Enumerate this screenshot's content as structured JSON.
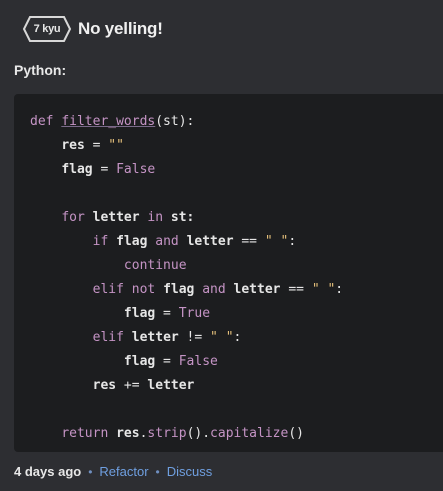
{
  "header": {
    "kyu_label": "7 kyu",
    "title": "No yelling!"
  },
  "language_label": "Python:",
  "code": {
    "l1": {
      "kw": "def",
      "fname": "filter_words",
      "args": "(st):"
    },
    "l2": {
      "var": "res",
      "op": " = ",
      "val": "\"\""
    },
    "l3": {
      "var": "flag",
      "op": " = ",
      "val": "False"
    },
    "l5": {
      "kw": "for",
      "var": "letter",
      "kw2": "in",
      "var2": "st:"
    },
    "l6": {
      "kw": "if",
      "var": "flag",
      "kw2": "and",
      "var2": "letter",
      "op": " == ",
      "val": "\" \"",
      "end": ":"
    },
    "l7": {
      "kw": "continue"
    },
    "l8": {
      "kw": "elif",
      "kw2": "not",
      "var": "flag",
      "kw3": "and",
      "var2": "letter",
      "op": " == ",
      "val": "\" \"",
      "end": ":"
    },
    "l9": {
      "var": "flag",
      "op": " = ",
      "val": "True"
    },
    "l10": {
      "kw": "elif",
      "var": "letter",
      "op": " != ",
      "val": "\" \"",
      "end": ":"
    },
    "l11": {
      "var": "flag",
      "op": " = ",
      "val": "False"
    },
    "l12": {
      "var": "res",
      "op": " += ",
      "var2": "letter"
    },
    "l14": {
      "kw": "return",
      "var": "res",
      "dot1": ".",
      "call1": "strip",
      "par1": "()",
      "dot2": ".",
      "call2": "capitalize",
      "par2": "()"
    }
  },
  "footer": {
    "time": "4 days ago",
    "refactor": "Refactor",
    "discuss": "Discuss",
    "separator": "•"
  }
}
